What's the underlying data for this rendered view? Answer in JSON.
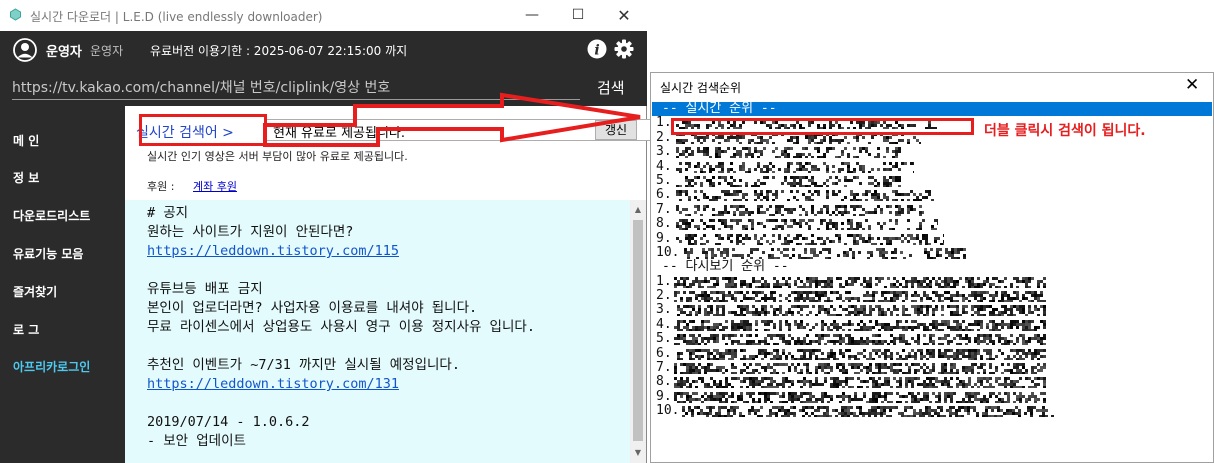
{
  "window": {
    "title": "실시간 다운로더 | L.E.D (live endlessly downloader)",
    "minimize": "—",
    "maximize": "☐",
    "close": "✕"
  },
  "header": {
    "user_name": "운영자",
    "user_role": "운영자",
    "license": "유료버전 이용기한 : 2025-06-07 22:15:00 까지",
    "url_placeholder": "https://tv.kakao.com/channel/채널 번호/cliplink/영상 번호",
    "search_label": "검색"
  },
  "sidebar": {
    "items": [
      "메 인",
      "정 보",
      "다운로드리스트",
      "유료기능 모음",
      "즐겨찾기",
      "로 그",
      "아프리카로그인"
    ]
  },
  "content": {
    "realtime_label": "실시간 검색어 >",
    "combo_value": "현재 유료로 제공됩니다.",
    "refresh_label": "갱신",
    "notice": "실시간 인기 영상은 서버 부담이 많아 유료로 제공됩니다.",
    "donate_label": "후원 :",
    "donate_link": "계좌 후원",
    "notice_lines": [
      {
        "text": "# 공지",
        "link": false
      },
      {
        "text": "원하는 사이트가 지원이 안된다면?",
        "link": false
      },
      {
        "text": "https://leddown.tistory.com/115",
        "link": true
      },
      {
        "text": "",
        "link": false
      },
      {
        "text": "유튜브등 배포 금지",
        "link": false
      },
      {
        "text": "본인이 업로더라면? 사업자용 이용료를 내셔야 됩니다.",
        "link": false
      },
      {
        "text": "무료 라이센스에서 상업용도 사용시 영구 이용 정지사유 입니다.",
        "link": false
      },
      {
        "text": "",
        "link": false
      },
      {
        "text": "추천인 이벤트가 ~7/31 까지만 실시될 예정입니다.",
        "link": false
      },
      {
        "text": "https://leddown.tistory.com/131",
        "link": true
      },
      {
        "text": "",
        "link": false
      },
      {
        "text": "2019/07/14 - 1.0.6.2",
        "link": false
      },
      {
        "text": "- 보안 업데이트",
        "link": false
      }
    ]
  },
  "ranking": {
    "title": "실시간 검색순위",
    "close": "✕",
    "realtime_header": "-- 실시간 순위 --",
    "replay_header": "-- 다시보기 순위 --",
    "realtime_items": [
      "1.",
      "2.",
      "3.",
      "4.",
      "5.",
      "6.",
      "7.",
      "8.",
      "9.",
      "10."
    ],
    "replay_items": [
      "1.",
      "2.",
      "3.",
      "4.",
      "5.",
      "6.",
      "7.",
      "8.",
      "9.",
      "10."
    ]
  },
  "annotation": {
    "text": "더블 클릭시 검색이 됩니다.",
    "color": "#e61e1e"
  }
}
